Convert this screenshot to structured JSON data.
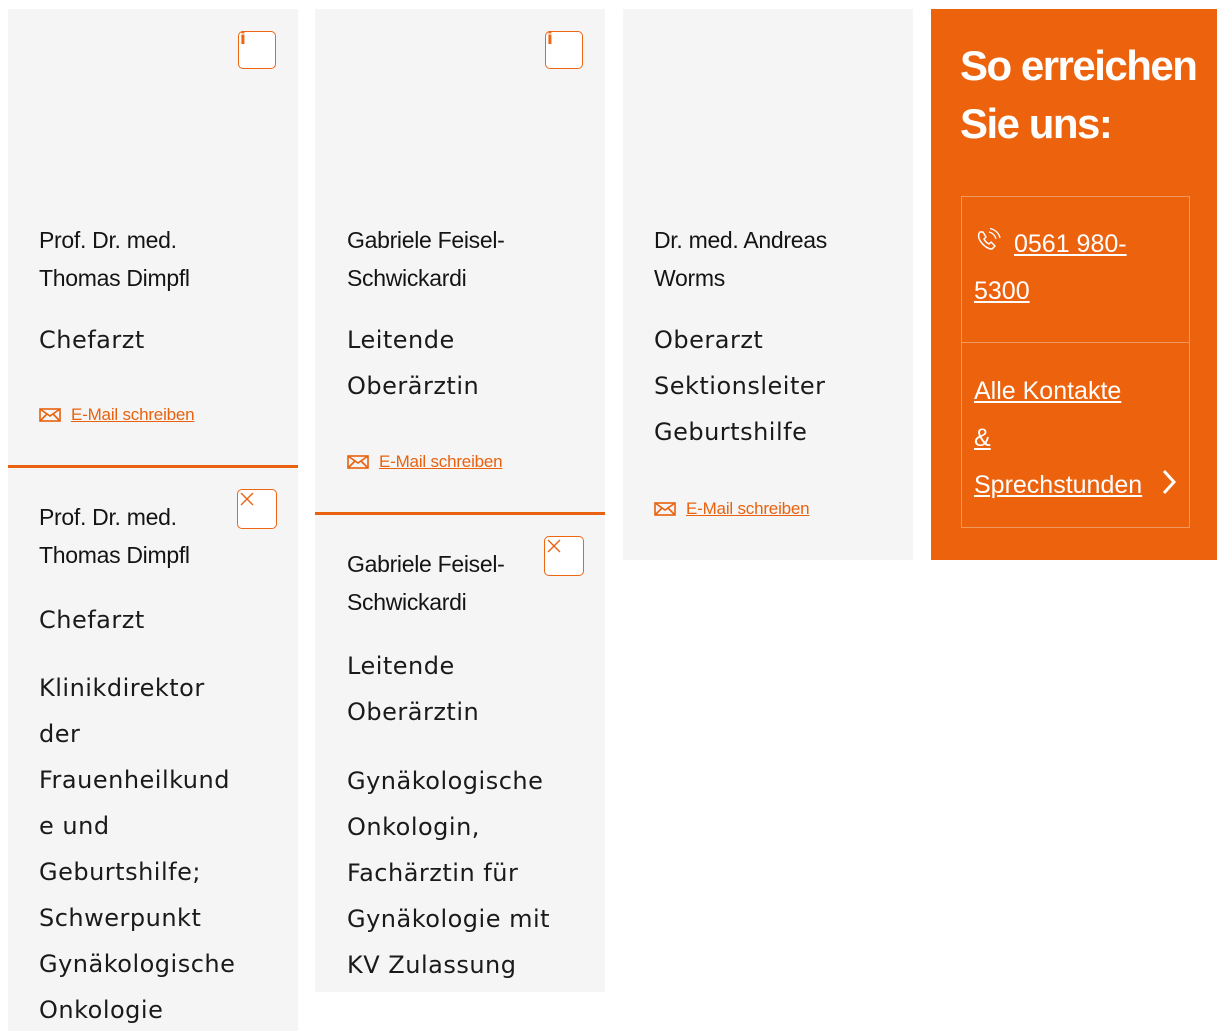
{
  "cards": [
    {
      "name_line1": "Prof. Dr. med.",
      "name_line2": "Thomas Dimpfl",
      "role": "Chefarzt",
      "mail": "E-Mail schreiben",
      "info_icon": "i"
    },
    {
      "name_line1": "Gabriele Feisel-",
      "name_line2": "Schwickardi",
      "role_line1": "Leitende",
      "role_line2": "Oberärztin",
      "mail": "E-Mail schreiben",
      "info_icon": "i"
    },
    {
      "name_line1": "Dr. med. Andreas",
      "name_line2": "Worms",
      "role_line1": "Oberarzt",
      "role_line2": "Sektionsleiter",
      "role_line3": "Geburtshilfe",
      "mail": "E-Mail schreiben"
    }
  ],
  "details": [
    {
      "name_line1": "Prof. Dr. med.",
      "name_line2": "Thomas Dimpfl",
      "role": "Chefarzt",
      "desc_lines": [
        "Klinikdirektor",
        "der",
        "Frauenheilkund",
        "e und",
        "Geburtshilfe;",
        "Schwerpunkt",
        "Gynäkologische",
        "Onkologie"
      ]
    },
    {
      "name_line1": "Gabriele Feisel-",
      "name_line2": "Schwickardi",
      "role_line1": "Leitende",
      "role_line2": "Oberärztin",
      "desc_lines": [
        "Gynäkologische",
        "Onkologin,",
        "Fachärztin für",
        "Gynäkologie mit",
        "KV Zulassung"
      ]
    }
  ],
  "contact": {
    "title_line1": "So erreichen",
    "title_line2": "Sie uns:",
    "phone_line1": "0561 980-",
    "phone_line2": "5300",
    "all_contacts_line1": "Alle Kontakte",
    "all_contacts_line2": "&",
    "all_contacts_line3": "Sprechstunden"
  },
  "colors": {
    "accent": "#ec620d",
    "card_bg": "#f5f5f5"
  },
  "icons": [
    "info-icon",
    "close-icon",
    "mail-icon",
    "phone-icon",
    "chevron-right-icon"
  ]
}
